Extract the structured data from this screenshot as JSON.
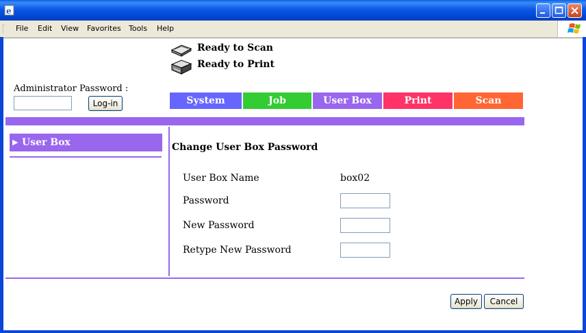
{
  "window": {
    "menu": [
      "File",
      "Edit",
      "View",
      "Favorites",
      "Tools",
      "Help"
    ]
  },
  "status": {
    "scan": "Ready to Scan",
    "print": "Ready to Print"
  },
  "login": {
    "label": "Administrator Password :",
    "password_value": "",
    "button": "Log-in"
  },
  "tabs": [
    {
      "label": "System",
      "color": "#6666ff"
    },
    {
      "label": "Job",
      "color": "#33cc33"
    },
    {
      "label": "User Box",
      "color": "#9966ee"
    },
    {
      "label": "Print",
      "color": "#ff3366"
    },
    {
      "label": "Scan",
      "color": "#ff6633"
    }
  ],
  "sidebar": {
    "items": [
      {
        "label": "User Box",
        "arrow": "▶"
      }
    ]
  },
  "form": {
    "title": "Change User Box Password",
    "box_name_label": "User Box Name",
    "box_name_value": "box02",
    "password_label": "Password",
    "new_password_label": "New Password",
    "retype_label": "Retype New Password",
    "password_value": "",
    "new_password_value": "",
    "retype_value": ""
  },
  "actions": {
    "apply": "Apply",
    "cancel": "Cancel"
  },
  "accent_color": "#9966ee"
}
